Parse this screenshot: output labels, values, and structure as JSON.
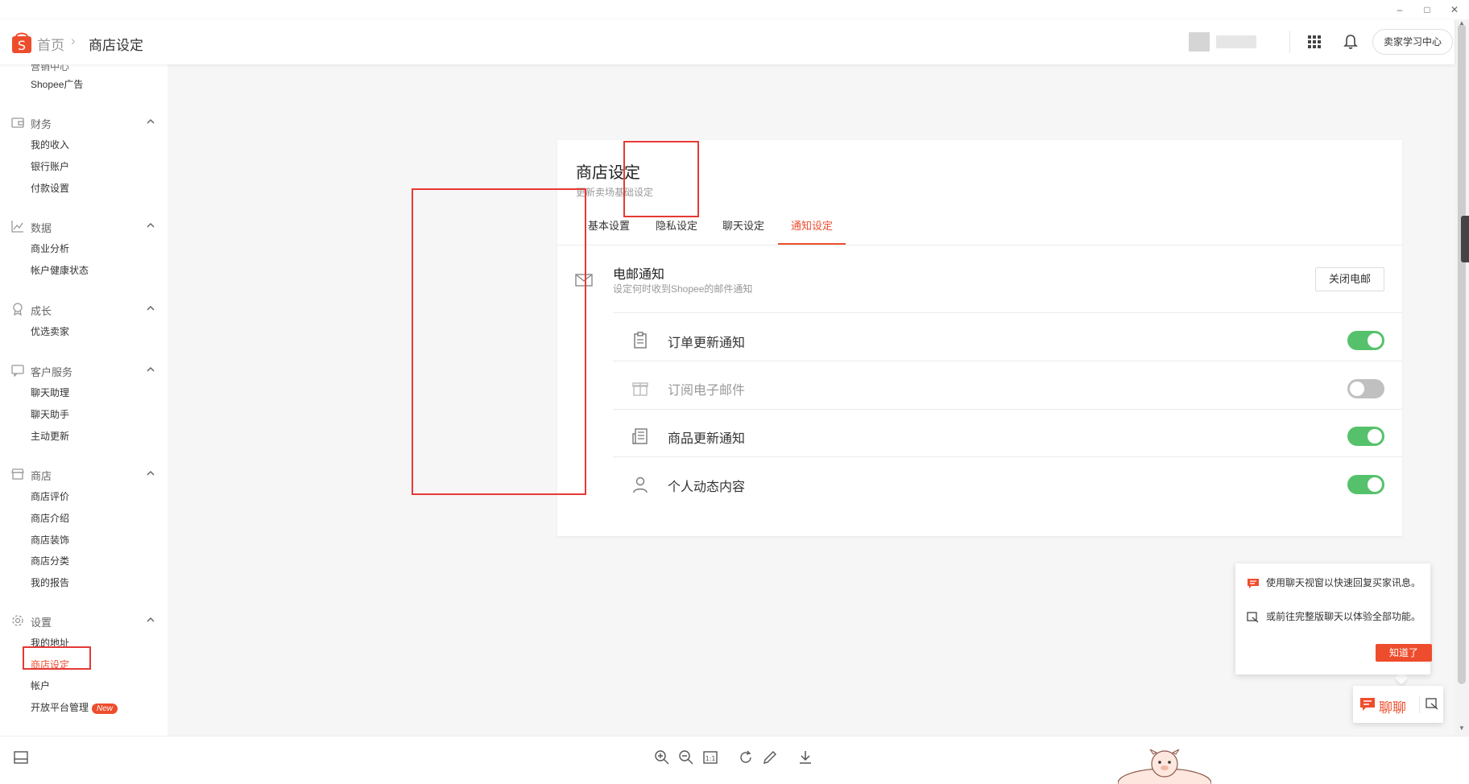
{
  "breadcrumb": {
    "home": "首页",
    "separator": "›",
    "current": "商店设定"
  },
  "header": {
    "learn_button": "卖家学习中心"
  },
  "sidebar": {
    "cut_item": "营销中心",
    "ads_item": "Shopee广告",
    "sections": [
      {
        "title": "财务",
        "icon": "wallet-icon",
        "items": [
          "我的收入",
          "银行账户",
          "付款设置"
        ]
      },
      {
        "title": "数据",
        "icon": "chart-icon",
        "items": [
          "商业分析",
          "帐户健康状态"
        ]
      },
      {
        "title": "成长",
        "icon": "medal-icon",
        "items": [
          "优选卖家"
        ]
      },
      {
        "title": "客户服务",
        "icon": "chat-icon",
        "items": [
          "聊天助理",
          "聊天助手",
          "主动更新"
        ]
      },
      {
        "title": "商店",
        "icon": "shop-icon",
        "items": [
          "商店评价",
          "商店介绍",
          "商店装饰",
          "商店分类",
          "我的报告"
        ]
      },
      {
        "title": "设置",
        "icon": "gear-icon",
        "items": [
          "我的地址",
          "商店设定",
          "帐户",
          "开放平台管理"
        ]
      }
    ],
    "new_badge": "New"
  },
  "page": {
    "title": "商店设定",
    "subtitle": "更新卖场基础设定",
    "tabs": [
      "基本设置",
      "隐私设定",
      "聊天设定",
      "通知设定"
    ],
    "active_tab": "通知设定"
  },
  "email_notifications": {
    "title": "电邮通知",
    "subtitle": "设定何时收到Shopee的邮件通知",
    "close_button": "关闭电邮",
    "rows": [
      {
        "label": "订单更新通知",
        "icon": "clipboard-icon",
        "enabled": true
      },
      {
        "label": "订阅电子邮件",
        "icon": "gift-icon",
        "enabled": false
      },
      {
        "label": "商品更新通知",
        "icon": "newspaper-icon",
        "enabled": true
      },
      {
        "label": "个人动态内容",
        "icon": "user-icon",
        "enabled": true
      }
    ]
  },
  "chat_popup": {
    "line1": "使用聊天视窗以快速回复买家讯息。",
    "line2": "或前往完整版聊天以体验全部功能。",
    "button": "知道了"
  },
  "chat_bar": {
    "label": "聊聊"
  },
  "viewer_toolbar": [
    "zoom-in-icon",
    "zoom-out-icon",
    "actual-size-icon",
    "rotate-icon",
    "edit-icon",
    "download-icon"
  ],
  "colors": {
    "brand": "#ee4d2d",
    "toggle_on": "#55c26b",
    "toggle_off": "#c0c0c0",
    "annotation": "#e53935"
  }
}
